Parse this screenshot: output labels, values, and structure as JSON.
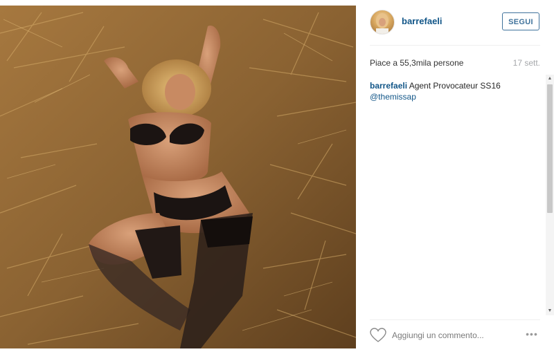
{
  "post": {
    "username": "barrefaeli",
    "follow_label": "SEGUI",
    "likes_text": "Piace a 55,3mila persone",
    "time_text": "17 sett.",
    "caption_user": "barrefaeli",
    "caption_text": "Agent Provocateur SS16",
    "caption_mention": "@themissap",
    "photo_icon": "photo-image"
  },
  "footer": {
    "comment_placeholder": "Aggiungi un commento...",
    "more_label": "•••",
    "heart_icon": "heart-outline-icon"
  },
  "colors": {
    "link": "#125688",
    "follow_border": "#3f729b",
    "muted": "#a5a7aa"
  }
}
